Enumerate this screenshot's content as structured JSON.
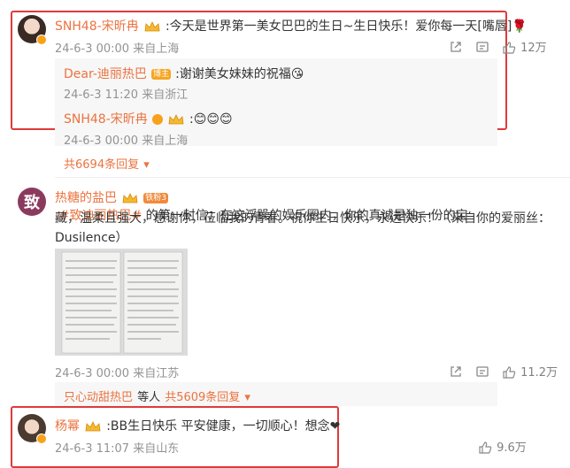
{
  "comments": [
    {
      "username": "SNH48-宋昕冉",
      "text": ":今天是世界第一美女巴巴的生日~生日快乐！爱你每一天[嘴唇]🌹",
      "meta": "24-6-3 00:00 来自上海",
      "likes": "12万",
      "replies": [
        {
          "username": "Dear-迪丽热巴",
          "badge": "博主",
          "text": ":谢谢美女妹妹的祝福😘",
          "meta": "24-6-3 11:20 来自浙江"
        },
        {
          "username": "SNH48-宋昕冉",
          "text": ":😊😊😊",
          "meta": "24-6-3 00:00 来自上海"
        }
      ],
      "reply_count": "共6694条回复"
    },
    {
      "username": "热糖的盐巴",
      "level_badge": "铁粉3",
      "hashtag": ":#致迪丽热巴#",
      "text_line1": " 的第一封信：在这浮躁的娱乐圈内，你的真诚是独一份的宝",
      "text_line2": "藏，温柔且强大，感谢你，莅临我的青春。祝你生日快乐，永远快乐！（来自你的爱丽丝：",
      "text_line3": "Dusilence）",
      "meta": "24-6-3 00:00 来自江苏",
      "likes": "11.2万",
      "reply_by": "只心动甜热巴",
      "reply_by_suffix": "等人",
      "reply_count": "共5609条回复"
    },
    {
      "username": "杨幂",
      "text": ":BB生日快乐 平安健康，一切顺心！想念❤",
      "meta": "24-6-3 11:07 来自山东",
      "likes": "9.6万"
    }
  ],
  "avatar_initial_2": "致",
  "colors": {
    "username": "#eb7340",
    "highlight_border": "#e03a3a",
    "meta": "#939393"
  }
}
